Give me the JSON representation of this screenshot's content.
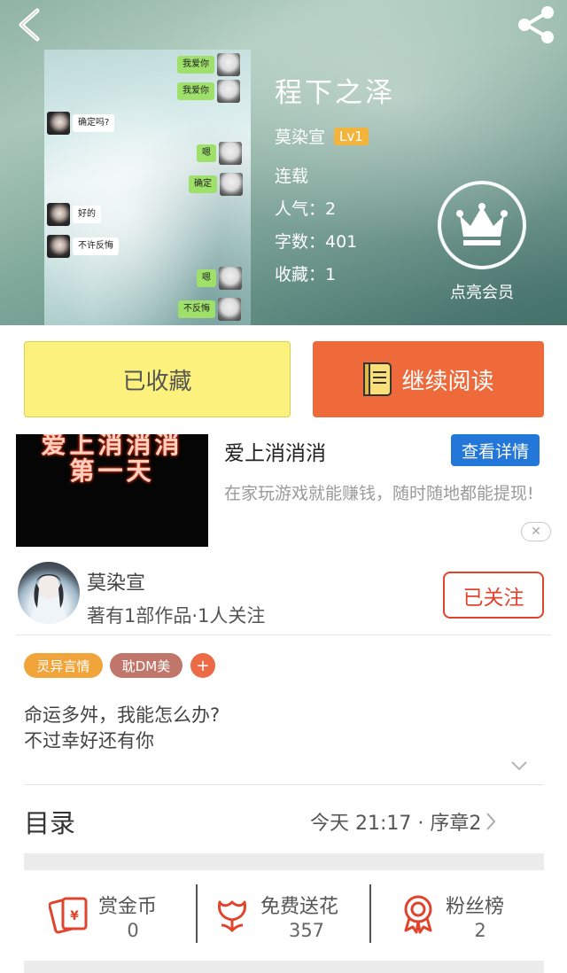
{
  "book": {
    "title": "程下之泽",
    "author": "莫染宣",
    "level": "Lv1",
    "status": "连载",
    "popularity": "人气：2",
    "word_count": "字数：401",
    "favorites": "收藏：1"
  },
  "vip": {
    "label": "点亮会员"
  },
  "cover_chat": [
    {
      "text": "我爱你",
      "side": "right"
    },
    {
      "text": "我爱你",
      "side": "right"
    },
    {
      "text": "确定吗?",
      "side": "left"
    },
    {
      "text": "嗯",
      "side": "right"
    },
    {
      "text": "确定",
      "side": "right"
    },
    {
      "text": "好的",
      "side": "left"
    },
    {
      "text": "不许反悔",
      "side": "left"
    },
    {
      "text": "嗯",
      "side": "right"
    },
    {
      "text": "不反悔",
      "side": "right"
    }
  ],
  "actions": {
    "collected_label": "已收藏",
    "continue_label": "继续阅读"
  },
  "ad": {
    "image_line1": "爱上消消消",
    "image_line2": "第一天",
    "title": "爱上消消消",
    "detail_button": "查看详情",
    "description": "在家玩游戏就能赚钱，随时随地都能提现!",
    "close_icon": "close-icon"
  },
  "author_card": {
    "name": "莫染宣",
    "stats": "著有1部作品·1人关注",
    "follow_label": "已关注"
  },
  "tags": [
    "灵异言情",
    "耽DM美",
    "+"
  ],
  "description": {
    "line1": "命运多舛，我能怎么办?",
    "line2": "不过幸好还有你"
  },
  "catalog": {
    "title": "目录",
    "latest": "今天 21:17 · 序章2"
  },
  "stats": [
    {
      "label": "赏金币",
      "value": "0",
      "icon": "red-envelope-icon"
    },
    {
      "label": "免费送花",
      "value": "357",
      "icon": "flower-icon"
    },
    {
      "label": "粉丝榜",
      "value": "2",
      "icon": "medal-icon"
    }
  ],
  "colors": {
    "collect_button": "#fbf17c",
    "read_button": "#ee6a3b",
    "accent_red": "#e0442c",
    "detail_blue": "#2277d9",
    "level_badge": "#f3b43d"
  }
}
